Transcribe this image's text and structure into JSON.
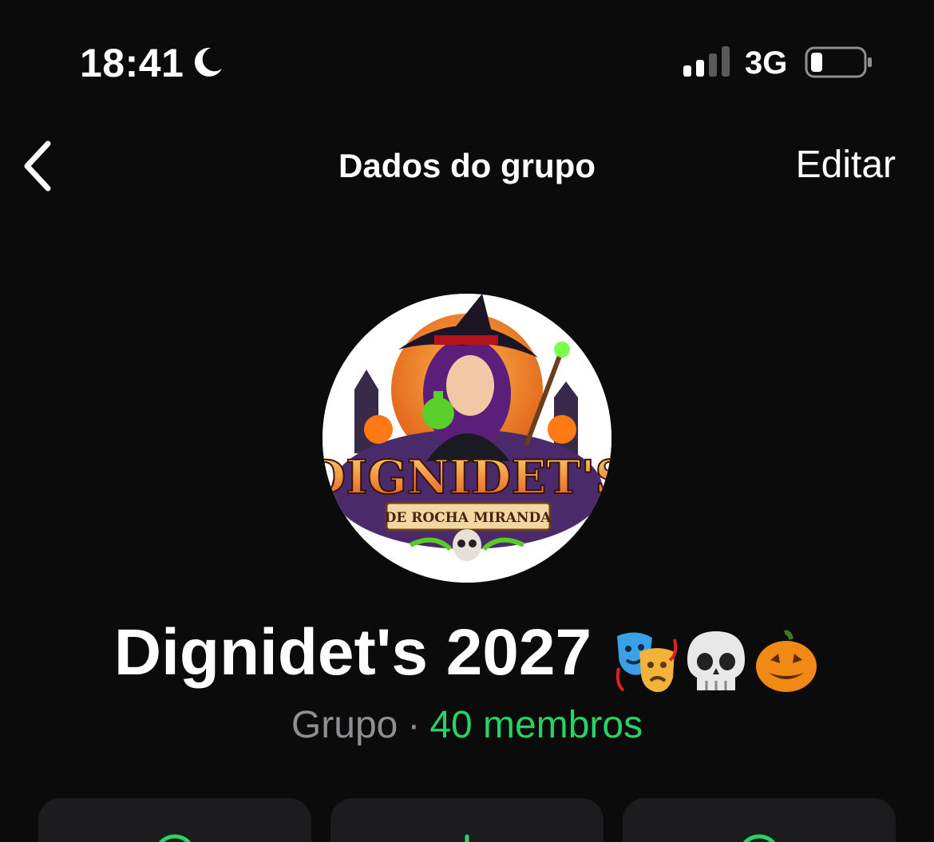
{
  "status_bar": {
    "time": "18:41",
    "network": "3G",
    "icons": [
      "moon-icon",
      "signal-icon",
      "battery-icon"
    ]
  },
  "nav": {
    "title": "Dados do grupo",
    "edit_label": "Editar",
    "back_icon": "chevron-left-icon"
  },
  "avatar": {
    "logo_text": "DIGNIDET'S",
    "logo_subtext": "DE ROCHA MIRANDA"
  },
  "group": {
    "name": "Dignidet's 2027",
    "emojis": [
      "performing-arts-emoji",
      "skull-emoji",
      "jack-o-lantern-emoji"
    ],
    "type": "Grupo",
    "separator": "·",
    "members": "40 membros"
  },
  "actions": [
    {
      "icon": "action-icon"
    },
    {
      "icon": "action-icon"
    },
    {
      "icon": "action-icon"
    }
  ],
  "colors": {
    "background": "#0b0b0b",
    "accent": "#25d366",
    "secondary_text": "#8e8e93",
    "card": "#1c1c1e"
  }
}
